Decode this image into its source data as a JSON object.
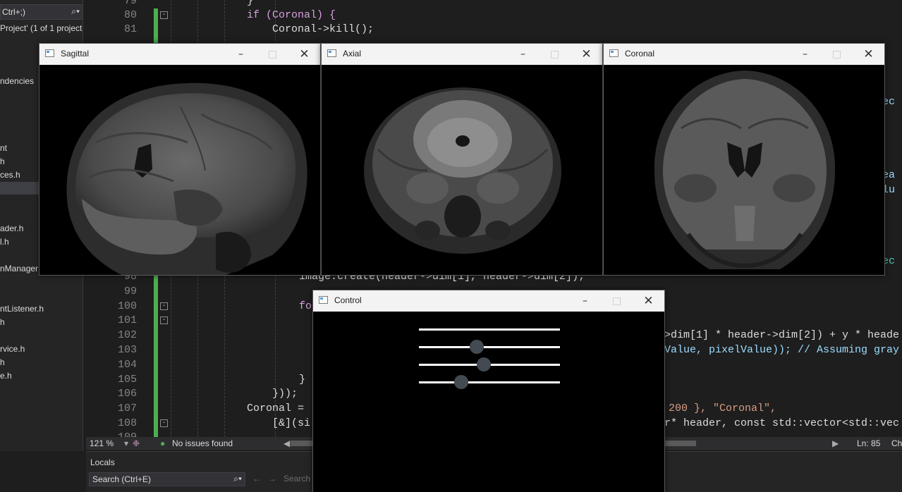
{
  "solution_explorer": {
    "search_text": "Ctrl+;)",
    "project_line": " Project' (1 of 1 project",
    "items": [
      "ndencies",
      "nt",
      "h",
      "ces.h",
      "ader.h",
      "l.h",
      "nManager",
      "ntListener.h",
      "h",
      "rvice.h",
      "h",
      "e.h"
    ]
  },
  "editor": {
    "lines": [
      {
        "num": "79",
        "text": "}"
      },
      {
        "num": "80",
        "text": "if (Coronal) {"
      },
      {
        "num": "81",
        "text": "Coronal->kill();"
      },
      {
        "num": "98",
        "text": "image.create(header->dim[1], header->dim[2]);"
      },
      {
        "num": "99",
        "text": ""
      },
      {
        "num": "100",
        "text": "fo"
      },
      {
        "num": "101",
        "text": ""
      },
      {
        "num": "102",
        "text": ">dim[1] * header->dim[2]) + y * heade"
      },
      {
        "num": "103",
        "text": "Value, pixelValue)); // Assuming gray"
      },
      {
        "num": "104",
        "text": ""
      },
      {
        "num": "105",
        "text": "}"
      },
      {
        "num": "106",
        "text": "}));"
      },
      {
        "num": "107",
        "text": "Coronal = "
      },
      {
        "num": "108",
        "text": "[&](si"
      },
      {
        "num": "109",
        "text": ""
      }
    ],
    "right_fragments": [
      "vec",
      "hea",
      "alu",
      "vec"
    ],
    "line107_tail": "200 }, \"Coronal\",",
    "line108_tail": "r* header, const std::vector<std::vec"
  },
  "status_bar": {
    "zoom": "121 %",
    "issues": "No issues found",
    "line_info": "Ln: 85",
    "char_info": "Ch"
  },
  "locals": {
    "title": "Locals",
    "search_placeholder": "Search (Ctrl+E)",
    "search_depth": "Search D"
  },
  "windows": {
    "sagittal": {
      "title": "Sagittal"
    },
    "axial": {
      "title": "Axial"
    },
    "coronal": {
      "title": "Coronal"
    },
    "control": {
      "title": "Control"
    }
  },
  "control_sliders": [
    {
      "name": "slider-1",
      "value": 0
    },
    {
      "name": "slider-2",
      "value": 0.41
    },
    {
      "name": "slider-3",
      "value": 0.46
    },
    {
      "name": "slider-4",
      "value": 0.3
    }
  ],
  "icons": {
    "search": "search-icon",
    "issues": "check-circle-icon",
    "window_minimize": "minimize-icon",
    "window_maximize": "maximize-icon",
    "window_close": "close-icon"
  },
  "colors": {
    "ide_bg": "#1e1e1e",
    "green_change_bar": "#4caf50",
    "keyword": "#d8a0df",
    "function": "#dcdcaa",
    "string": "#d69d85",
    "comment": "#57a64a"
  }
}
